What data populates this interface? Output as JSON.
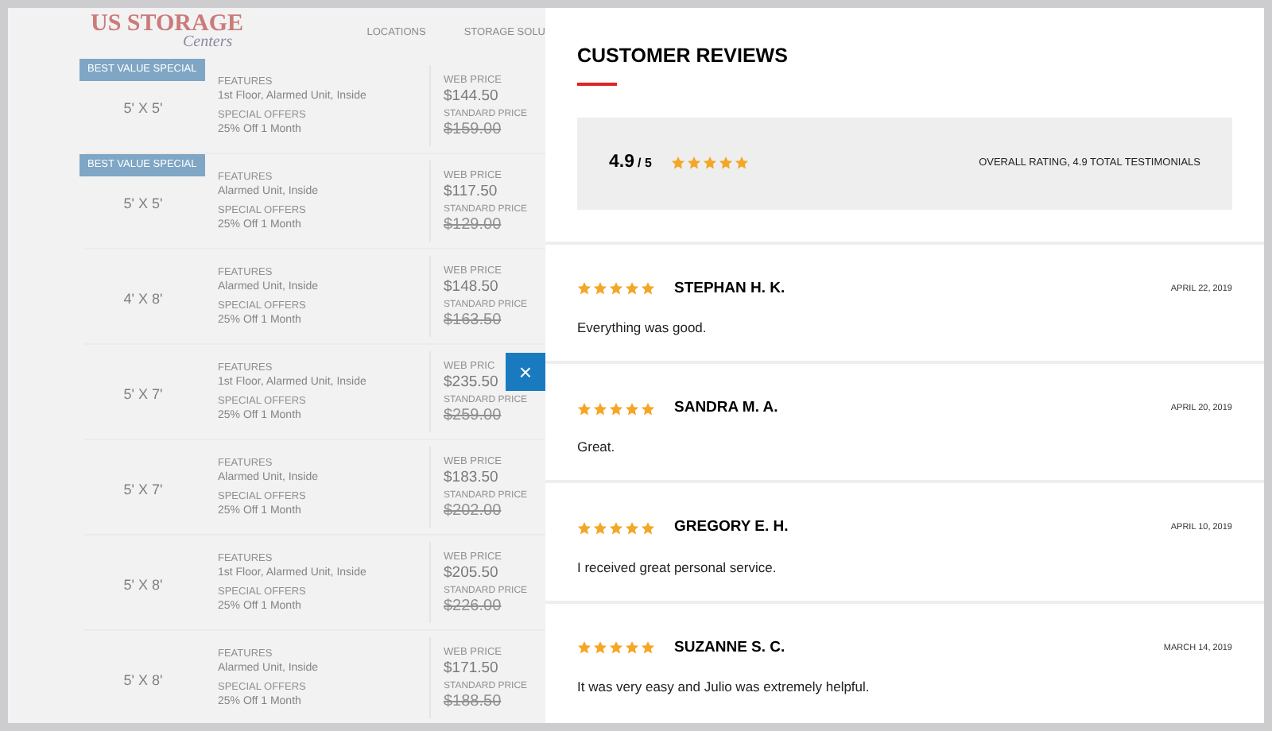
{
  "header": {
    "logo_top": "US STORAGE",
    "logo_script": "Centers",
    "nav": [
      "LOCATIONS",
      "STORAGE SOLU"
    ]
  },
  "units": [
    {
      "badge": "BEST VALUE SPECIAL",
      "size": "5' X 5'",
      "features_label": "FEATURES",
      "features": "1st Floor, Alarmed Unit, Inside",
      "offers_label": "SPECIAL OFFERS",
      "offer": "25% Off 1 Month",
      "web_price_label": "WEB PRICE",
      "web_price": "$144.50",
      "standard_price_label": "STANDARD PRICE",
      "standard_price": "$159.00"
    },
    {
      "badge": "BEST VALUE SPECIAL",
      "size": "5' X 5'",
      "features_label": "FEATURES",
      "features": "Alarmed Unit, Inside",
      "offers_label": "SPECIAL OFFERS",
      "offer": "25% Off 1 Month",
      "web_price_label": "WEB PRICE",
      "web_price": "$117.50",
      "standard_price_label": "STANDARD PRICE",
      "standard_price": "$129.00"
    },
    {
      "size": "4' X 8'",
      "features_label": "FEATURES",
      "features": "Alarmed Unit, Inside",
      "offers_label": "SPECIAL OFFERS",
      "offer": "25% Off 1 Month",
      "web_price_label": "WEB PRICE",
      "web_price": "$148.50",
      "standard_price_label": "STANDARD PRICE",
      "standard_price": "$163.50"
    },
    {
      "size": "5' X 7'",
      "features_label": "FEATURES",
      "features": "1st Floor, Alarmed Unit, Inside",
      "offers_label": "SPECIAL OFFERS",
      "offer": "25% Off 1 Month",
      "web_price_label": "WEB PRIC",
      "web_price": "$235.50",
      "standard_price_label": "STANDARD PRICE",
      "standard_price": "$259.00"
    },
    {
      "size": "5' X 7'",
      "features_label": "FEATURES",
      "features": "Alarmed Unit, Inside",
      "offers_label": "SPECIAL OFFERS",
      "offer": "25% Off 1 Month",
      "web_price_label": "WEB PRICE",
      "web_price": "$183.50",
      "standard_price_label": "STANDARD PRICE",
      "standard_price": "$202.00"
    },
    {
      "size": "5' X 8'",
      "features_label": "FEATURES",
      "features": "1st Floor, Alarmed Unit, Inside",
      "offers_label": "SPECIAL OFFERS",
      "offer": "25% Off 1 Month",
      "web_price_label": "WEB PRICE",
      "web_price": "$205.50",
      "standard_price_label": "STANDARD PRICE",
      "standard_price": "$226.00"
    },
    {
      "size": "5' X 8'",
      "features_label": "FEATURES",
      "features": "Alarmed Unit, Inside",
      "offers_label": "SPECIAL OFFERS",
      "offer": "25% Off 1 Month",
      "web_price_label": "WEB PRICE",
      "web_price": "$171.50",
      "standard_price_label": "STANDARD PRICE",
      "standard_price": "$188.50"
    }
  ],
  "close_button": "×",
  "reviews_panel": {
    "title": "CUSTOMER REVIEWS",
    "summary": {
      "score": "4.9",
      "out_of": "/ 5",
      "stars": 5,
      "caption": "OVERALL RATING, 4.9 TOTAL TESTIMONIALS"
    },
    "reviews": [
      {
        "stars": 5,
        "name": "STEPHAN H. K.",
        "date": "APRIL 22, 2019",
        "text": "Everything was good."
      },
      {
        "stars": 5,
        "name": "SANDRA M. A.",
        "date": "APRIL 20, 2019",
        "text": "Great."
      },
      {
        "stars": 5,
        "name": "GREGORY E. H.",
        "date": "APRIL 10, 2019",
        "text": "I received great personal service."
      },
      {
        "stars": 5,
        "name": "SUZANNE S. C.",
        "date": "MARCH 14, 2019",
        "text": "It was very easy and Julio was extremely helpful."
      }
    ]
  }
}
